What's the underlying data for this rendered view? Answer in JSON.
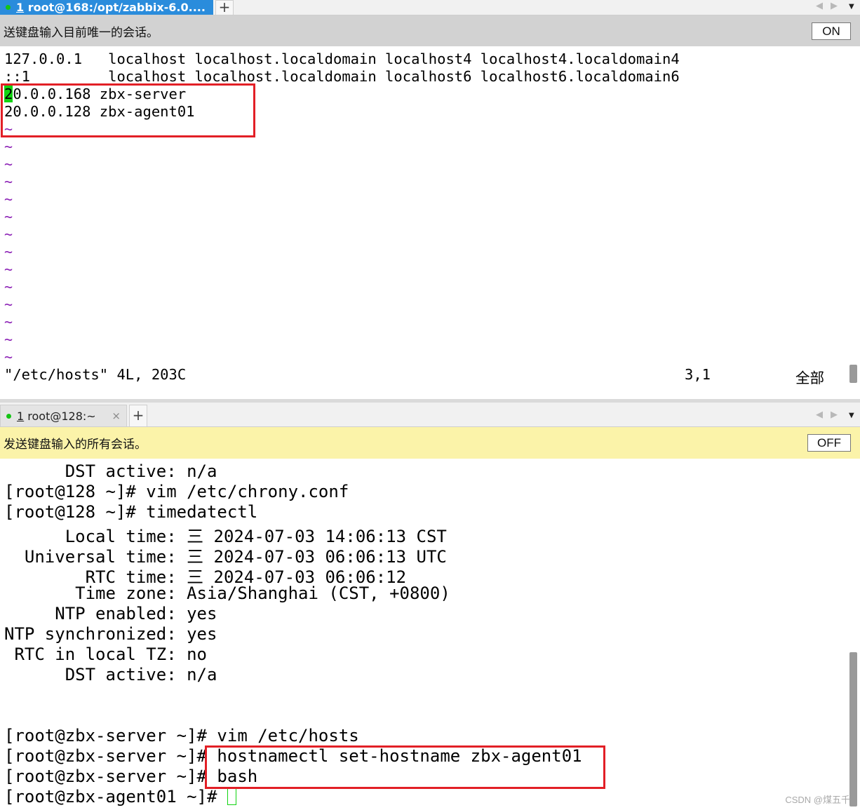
{
  "pane1": {
    "tab": {
      "number": "1",
      "label": "root@168:/opt/zabbix-6.0....",
      "close": "×"
    },
    "plus": "+",
    "notice": {
      "text": "送键盘输入目前唯一的会话。",
      "button": "ON",
      "bg": "#d2d2d2"
    },
    "lines": [
      "127.0.0.1   localhost localhost.localdomain localhost4 localhost4.localdomain4",
      "::1         localhost localhost.localdomain localhost6 localhost6.localdomain6",
      "0.0.0.168 zbx-server",
      "20.0.0.128 zbx-agent01"
    ],
    "cursor_char": "2",
    "tilde": "~",
    "status": {
      "file": "\"/etc/hosts\" 4L, 203C",
      "pos": "3,1",
      "range": "全部"
    }
  },
  "pane2": {
    "tab": {
      "number": "1",
      "label": "root@128:~",
      "close": "×"
    },
    "plus": "+",
    "notice": {
      "text": "发送键盘输入的所有会话。",
      "button": "OFF",
      "bg": "#fbf3a9"
    },
    "lines": [
      "      DST active: n/a",
      "[root@128 ~]# vim /etc/chrony.conf",
      "[root@128 ~]# timedatectl",
      "      Local time: 三 2024-07-03 14:06:13 CST",
      "  Universal time: 三 2024-07-03 06:06:13 UTC",
      "        RTC time: 三 2024-07-03 06:06:12",
      "       Time zone: Asia/Shanghai (CST, +0800)",
      "     NTP enabled: yes",
      "NTP synchronized: yes",
      " RTC in local TZ: no",
      "      DST active: n/a",
      "[root@zbx-server ~]# vim /etc/hosts",
      "[root@zbx-server ~]# hostnamectl set-hostname zbx-agent01",
      "[root@zbx-server ~]# bash",
      "[root@zbx-agent01 ~]# "
    ]
  },
  "watermark": "CSDN @煤五千",
  "colors": {
    "highlight": "#e21f26",
    "cursor": "#12d412",
    "tilde": "#8b1fb5",
    "tab_active": "#2a8cdc"
  }
}
